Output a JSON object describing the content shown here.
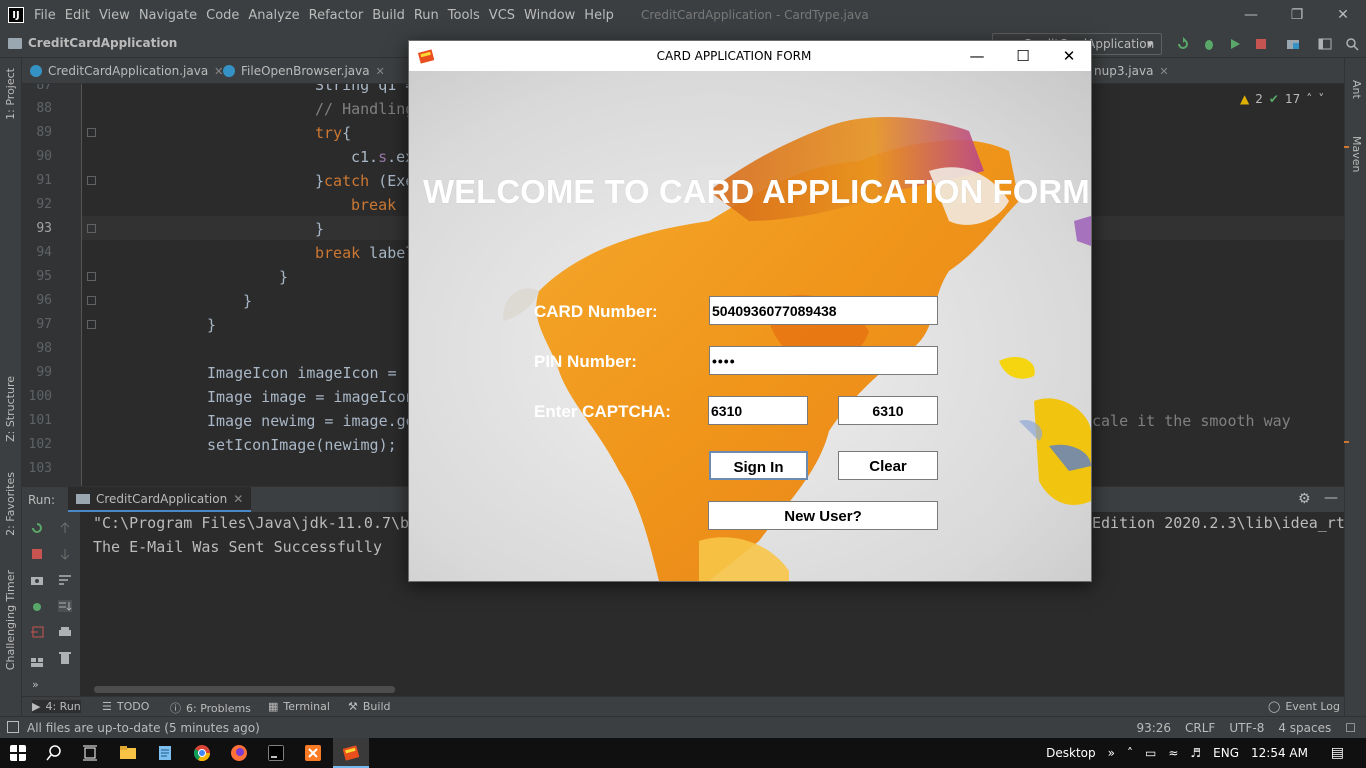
{
  "ide": {
    "menu": [
      "File",
      "Edit",
      "View",
      "Navigate",
      "Code",
      "Analyze",
      "Refactor",
      "Build",
      "Run",
      "Tools",
      "VCS",
      "Window",
      "Help"
    ],
    "window_title": "CreditCardApplication - CardType.java",
    "project_name": "CreditCardApplication",
    "run_config": "CreditCardApplication",
    "tabs": [
      {
        "label": "CreditCardApplication.java"
      },
      {
        "label": "FileOpenBrowser.java"
      },
      {
        "label": "nup3.java"
      }
    ],
    "inspections": {
      "warnings": "2",
      "weak_warnings": "17"
    },
    "line_numbers": [
      "87",
      "88",
      "89",
      "90",
      "91",
      "92",
      "93",
      "94",
      "95",
      "96",
      "97",
      "98",
      "99",
      "100",
      "101",
      "102",
      "103"
    ],
    "current_line": "93",
    "code": {
      "l87": "String q1 = ",
      "l88": "// Handling",
      "l89a": "try",
      "l89b": "{",
      "l90a": "c1.",
      "l90b": "s",
      "l90c": ".ex",
      "l91a": "}",
      "l91b": "catch",
      "l91c": " (Exe",
      "l92": "break ",
      "l93": "}",
      "l94a": "break",
      "l94b": " label",
      "l95": "}",
      "l96": "}",
      "l97": "}",
      "l99": "ImageIcon imageIcon = ",
      "l100": "Image image = imageIcon",
      "l101": "Image newimg = image.ge",
      "l101_right": "cale it the smooth way",
      "l102": "setIconImage(newimg);"
    },
    "left_strip": {
      "project": "1: Project",
      "structure": "Z: Structure",
      "favorites": "2: Favorites",
      "timer": "Challenging Timer"
    },
    "right_strip": {
      "ant": "Ant",
      "maven": "Maven"
    },
    "run_label": "Run:",
    "run_tab": "CreditCardApplication",
    "console": {
      "line1": "\"C:\\Program Files\\Java\\jdk-11.0.7\\b",
      "line1_right": "Edition 2020.2.3\\lib\\idea_rt",
      "line2": "The E-Mail Was Sent Successfully"
    },
    "tool_tabs": [
      "4: Run",
      "TODO",
      "6: Problems",
      "Terminal",
      "Build"
    ],
    "event_log": "Event Log",
    "status": {
      "message": "All files are up-to-date (5 minutes ago)",
      "position": "93:26",
      "line_sep": "CRLF",
      "encoding": "UTF-8",
      "indent": "4 spaces"
    }
  },
  "form": {
    "window_title": "CARD APPLICATION FORM",
    "heading": "WELCOME TO CARD APPLICATION FORM",
    "card_label": "CARD Number:",
    "card_value": "5040936077089438",
    "pin_label": "PIN Number:",
    "pin_value": "••••",
    "captcha_label": "Enter CAPTCHA:",
    "captcha_input": "6310",
    "captcha_code": "6310",
    "signin": "Sign In",
    "clear": "Clear",
    "new_user": "New User?"
  },
  "taskbar": {
    "desktop": "Desktop",
    "language": "ENG",
    "time": "12:54 AM"
  },
  "colors": {
    "ide_bg": "#2b2b2b",
    "panel": "#3c3f41",
    "keyword": "#cc7832",
    "comment": "#808080",
    "map_orange": "#f0a020"
  }
}
